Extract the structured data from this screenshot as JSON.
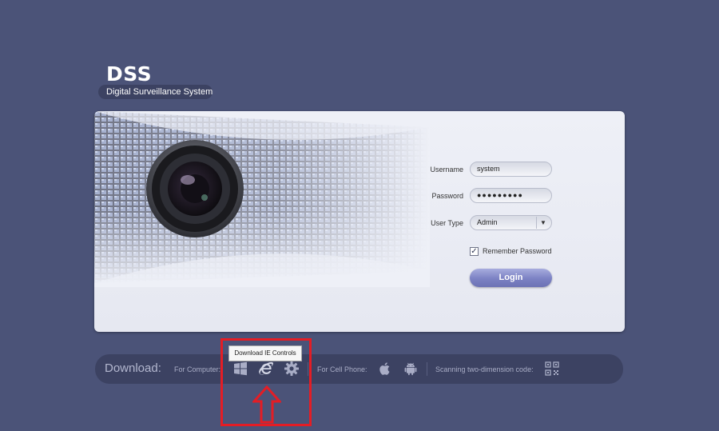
{
  "app": {
    "title": "DSS",
    "subtitle": "Digital Surveillance System"
  },
  "login": {
    "username_label": "Username",
    "username_value": "system",
    "password_label": "Password",
    "password_value": "●●●●●●●●●",
    "user_type_label": "User Type",
    "user_type_value": "Admin",
    "remember_label": "Remember Password",
    "remember_checked": true,
    "login_button": "Login"
  },
  "download": {
    "title": "Download:",
    "for_computer": "For Computer:",
    "for_cell_phone": "For Cell Phone:",
    "scanning": "Scanning two-dimension code:",
    "tooltip": "Download IE Controls",
    "icons": [
      "windows-icon",
      "ie-icon",
      "gear-icon",
      "apple-icon",
      "android-icon",
      "qr-code-icon"
    ]
  },
  "colors": {
    "background": "#4b5378",
    "bar": "#3c4262",
    "login_button": "#7b81c3",
    "annotation": "#e41d25"
  }
}
